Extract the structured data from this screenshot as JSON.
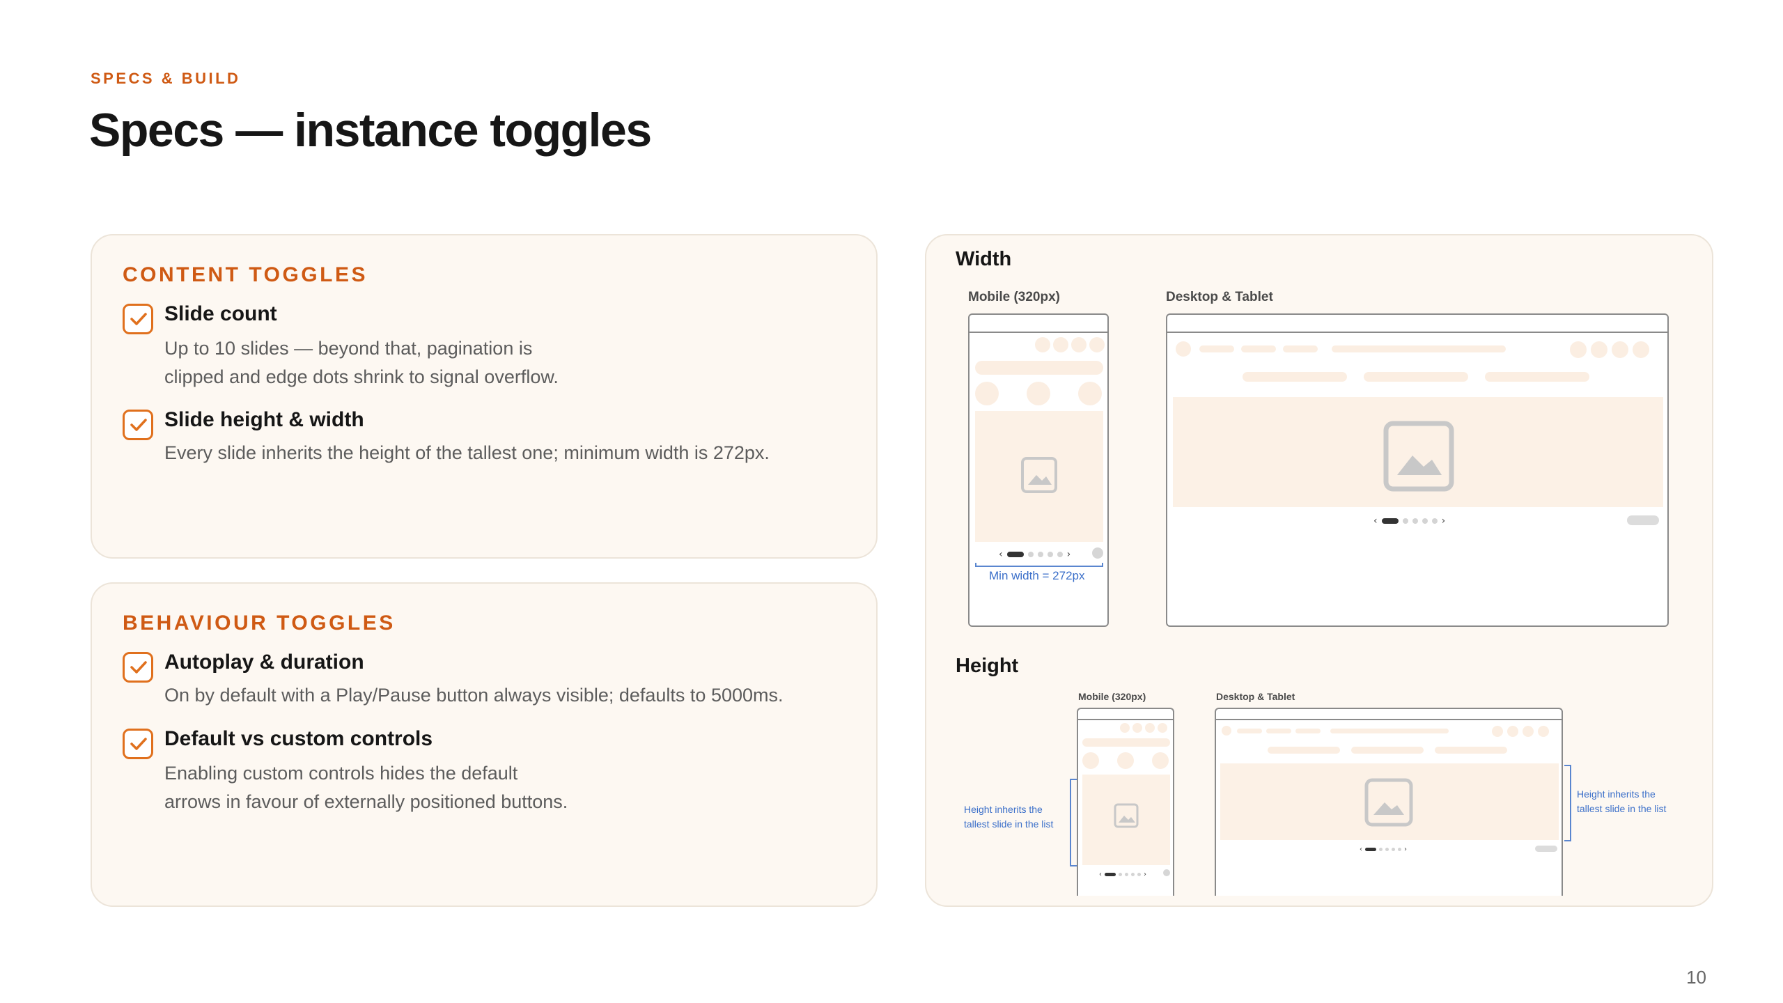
{
  "header": {
    "eyebrow": "SPECS & BUILD",
    "title": "Specs — instance toggles",
    "page_number": "10"
  },
  "content_toggles": {
    "heading": "CONTENT TOGGLES",
    "items": [
      {
        "title": "Slide count",
        "desc_line1": "Up to 10 slides — beyond that, pagination is",
        "desc_line2": "clipped and edge dots shrink to signal overflow.",
        "checked": true
      },
      {
        "title": "Slide height & width",
        "desc_line1": "Every slide inherits the height of the tallest one; minimum width is 272px.",
        "desc_line2": "",
        "checked": true
      }
    ]
  },
  "behaviour_toggles": {
    "heading": "BEHAVIOUR TOGGLES",
    "items": [
      {
        "title": "Autoplay & duration",
        "desc_line1": "On by default with a Play/Pause button always visible; defaults to 5000ms.",
        "desc_line2": "",
        "checked": true
      },
      {
        "title": "Default vs custom controls",
        "desc_line1": "Enabling custom controls hides the default",
        "desc_line2": "arrows in favour of externally positioned buttons.",
        "checked": true
      }
    ]
  },
  "diagram": {
    "width_label": "Width",
    "height_label": "Height",
    "mobile_label": "Mobile (320px)",
    "desktop_label": "Desktop & Tablet",
    "min_width_annotation": "Min width = 272px",
    "height_annotation_line1": "Height inherits the",
    "height_annotation_line2": "tallest slide in the list",
    "icons": [
      "image-placeholder-icon",
      "chevron-left-icon",
      "chevron-right-icon",
      "checkbox-checked-icon"
    ],
    "colors": {
      "accent": "#cf5a14",
      "annotation": "#3b6fc9",
      "card_bg": "#fdf8f2",
      "skeleton": "#fbeee2"
    }
  }
}
